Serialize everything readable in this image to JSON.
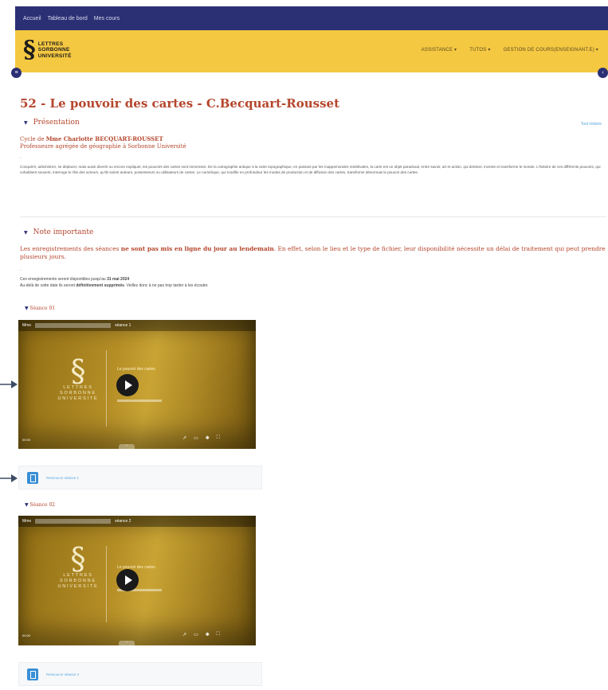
{
  "topnav": {
    "links": [
      "Accueil",
      "Tableau de bord",
      "Mes cours"
    ]
  },
  "header": {
    "logo_mark": "§",
    "logo_lines": [
      "LETTRES",
      "SORBONNE",
      "UNIVERSITÉ"
    ],
    "nav": [
      "ASSISTANCE ▾",
      "TUTOS ▾",
      "GESTION DE COURS(ENSEIGNANT.E) ▾"
    ]
  },
  "page_title": "52 - Le pouvoir des cartes - C.Becquart-Rousset",
  "presentation": {
    "heading": "Présentation",
    "collapse_all": "Tout réduire",
    "cycle_prefix": "Cycle de ",
    "cycle_name": "Mme Charlotte BECQUART-ROUSSET",
    "cycle_role": "Professeure agrégée de géographie à Sorbonne Université",
    "dot": ".",
    "description": "Conquérir, administrer, se déplacer, mais aussi divertir ou encore expliquer, les pouvoirs des cartes sont immenses. De la cartographie antique à la carte topographique, en passant par les mappemondes médiévales, la carte est un objet paradoxal, entre savoir, art et action, qui dessine, invente et transforme le monde. L'histoire de ces différents pouvoirs, qui cohabitent souvent, interroge le rôle des acteurs, qu'ils soient auteurs, possesseurs ou utilisateurs de cartes. Le numérique, qui modifie en profondeur les modes de production et de diffusion des cartes, transforme désormais le pouvoir des cartes."
  },
  "note": {
    "heading": "Note importante",
    "text_a": "Les enregistrements des séances ",
    "text_bold": "ne sont pas mis en ligne du jour au lendemain",
    "text_b": ". En effet, selon le lieu et le type de fichier, leur disponibilité nécessite un délai de traitement qui peut prendre plusieurs jours.",
    "dot": ".",
    "avail_a": "Ces enregistrements seront disponibles jusqu'au ",
    "avail_date": "31 mai 2024",
    "avail_b": "Au-delà de cette date ils seront ",
    "avail_bold": "définitivement supprimés",
    "avail_c": ". Veillez donc à ne pas trop tarder à les écouter."
  },
  "sessions": [
    {
      "heading": "Séance 01",
      "video_prefix": "Mme",
      "video_name": "séance 1",
      "logo_lines": [
        "LETTRES",
        "SORBONNE",
        "UNIVERSITÉ"
      ],
      "caption": "Le pouvoir des cartes",
      "time": "00:00",
      "resource": "Ressource séance 1"
    },
    {
      "heading": "Séance 02",
      "video_prefix": "Mme",
      "video_name": "séance 2",
      "logo_lines": [
        "LETTRES",
        "SORBONNE",
        "UNIVERSITÉ"
      ],
      "caption": "Le pouvoir des cartes",
      "time": "00:00",
      "resource": "Ressource séance 2"
    }
  ],
  "icons": {
    "sidebar_toggle": "hamburger-icon",
    "drawer_toggle": "chevron-left-icon",
    "collapse": "chevron-down-icon",
    "play": "play-icon",
    "file": "file-icon"
  },
  "colors": {
    "navy": "#2b3074",
    "gold": "#f5c842",
    "accent_red": "#b5462d",
    "link_blue": "#5aa9e0"
  }
}
